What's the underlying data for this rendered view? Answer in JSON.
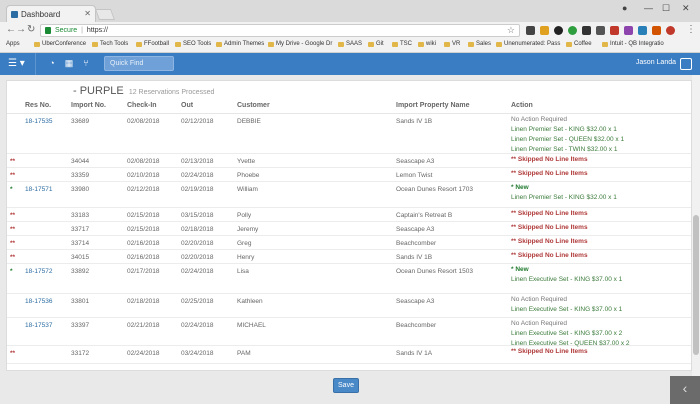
{
  "browser": {
    "tab_title": "Dashboard",
    "url_secure": "Secure",
    "url_sep": "|",
    "url": "https://",
    "bookmarks": [
      "Apps",
      "UberConference",
      "Tech Tools",
      "FFootball",
      "SEO Tools",
      "Admin Themes",
      "My Drive - Google Dr",
      "SAAS",
      "Git",
      "TSC",
      "wiki",
      "VR",
      "Sales",
      "Unenumerated: Pass",
      "Coffee",
      "Intuit - QB Integratio"
    ]
  },
  "appbar": {
    "quick_find_placeholder": "Quick Find",
    "user_name": "Jason Landa"
  },
  "page": {
    "title": "- PURPLE",
    "subtitle": "12 Reservations Processed",
    "save_label": "Save"
  },
  "columns": [
    "Res No.",
    "Import No.",
    "Check-In",
    "Out",
    "Customer",
    "Import Property Name",
    "Action"
  ],
  "rows": [
    {
      "flag": "",
      "res": "18-17535",
      "import": "33689",
      "checkin": "02/08/2018",
      "out": "02/12/2018",
      "customer": "DEBBIE",
      "property": "Sands IV 1B",
      "actions": [
        "No Action Required",
        "Linen Premier Set - KING $32.00 x 1",
        "Linen Premier Set - QUEEN $32.00 x 1",
        "Linen Premier Set - TWIN $32.00 x 1"
      ],
      "styles": [
        "muted",
        "green",
        "green",
        "green"
      ]
    },
    {
      "flag": "**",
      "res": "",
      "import": "34044",
      "checkin": "02/08/2018",
      "out": "02/13/2018",
      "customer": "Yvette",
      "property": "Seascape A3",
      "actions": [
        "** Skipped No Line Items"
      ],
      "styles": [
        "red"
      ]
    },
    {
      "flag": "**",
      "res": "",
      "import": "33359",
      "checkin": "02/10/2018",
      "out": "02/24/2018",
      "customer": "Phoebe",
      "property": "Lemon Twist",
      "actions": [
        "** Skipped No Line Items"
      ],
      "styles": [
        "red"
      ]
    },
    {
      "flag": "*",
      "res": "18-17571",
      "import": "33980",
      "checkin": "02/12/2018",
      "out": "02/19/2018",
      "customer": "William",
      "property": "Ocean Dunes Resort 1703",
      "actions": [
        "* New",
        "Linen Premier Set - KING $32.00 x 1"
      ],
      "styles": [
        "new",
        "green"
      ]
    },
    {
      "flag": "**",
      "res": "",
      "import": "33183",
      "checkin": "02/15/2018",
      "out": "03/15/2018",
      "customer": "Polly",
      "property": "Captain's Retreat B",
      "actions": [
        "** Skipped No Line Items"
      ],
      "styles": [
        "red"
      ]
    },
    {
      "flag": "**",
      "res": "",
      "import": "33717",
      "checkin": "02/15/2018",
      "out": "02/18/2018",
      "customer": "Jeremy",
      "property": "Seascape A3",
      "actions": [
        "** Skipped No Line Items"
      ],
      "styles": [
        "red"
      ]
    },
    {
      "flag": "**",
      "res": "",
      "import": "33714",
      "checkin": "02/16/2018",
      "out": "02/20/2018",
      "customer": "Greg",
      "property": "Beachcomber",
      "actions": [
        "** Skipped No Line Items"
      ],
      "styles": [
        "red"
      ]
    },
    {
      "flag": "**",
      "res": "",
      "import": "34015",
      "checkin": "02/16/2018",
      "out": "02/20/2018",
      "customer": "Henry",
      "property": "Sands IV 1B",
      "actions": [
        "** Skipped No Line Items"
      ],
      "styles": [
        "red"
      ]
    },
    {
      "flag": "*",
      "res": "18-17572",
      "import": "33892",
      "checkin": "02/17/2018",
      "out": "02/24/2018",
      "customer": "Lisa",
      "property": "Ocean Dunes Resort 1503",
      "actions": [
        "* New",
        "Linen Executive Set - KING $37.00 x 1"
      ],
      "styles": [
        "new",
        "green"
      ]
    },
    {
      "flag": "",
      "res": "18-17536",
      "import": "33801",
      "checkin": "02/18/2018",
      "out": "02/25/2018",
      "customer": "Kathleen",
      "property": "Seascape A3",
      "actions": [
        "No Action Required",
        "Linen Executive Set - KING $37.00 x 1"
      ],
      "styles": [
        "muted",
        "green"
      ]
    },
    {
      "flag": "",
      "res": "18-17537",
      "import": "33397",
      "checkin": "02/21/2018",
      "out": "02/24/2018",
      "customer": "MICHAEL",
      "property": "Beachcomber",
      "actions": [
        "No Action Required",
        "Linen Executive Set - KING $37.00 x 2",
        "Linen Executive Set - QUEEN $37.00 x 2"
      ],
      "styles": [
        "muted",
        "green",
        "green"
      ]
    },
    {
      "flag": "**",
      "res": "",
      "import": "33172",
      "checkin": "02/24/2018",
      "out": "03/24/2018",
      "customer": "PAM",
      "property": "Sands IV 1A",
      "actions": [
        "** Skipped No Line Items"
      ],
      "styles": [
        "red"
      ]
    }
  ]
}
